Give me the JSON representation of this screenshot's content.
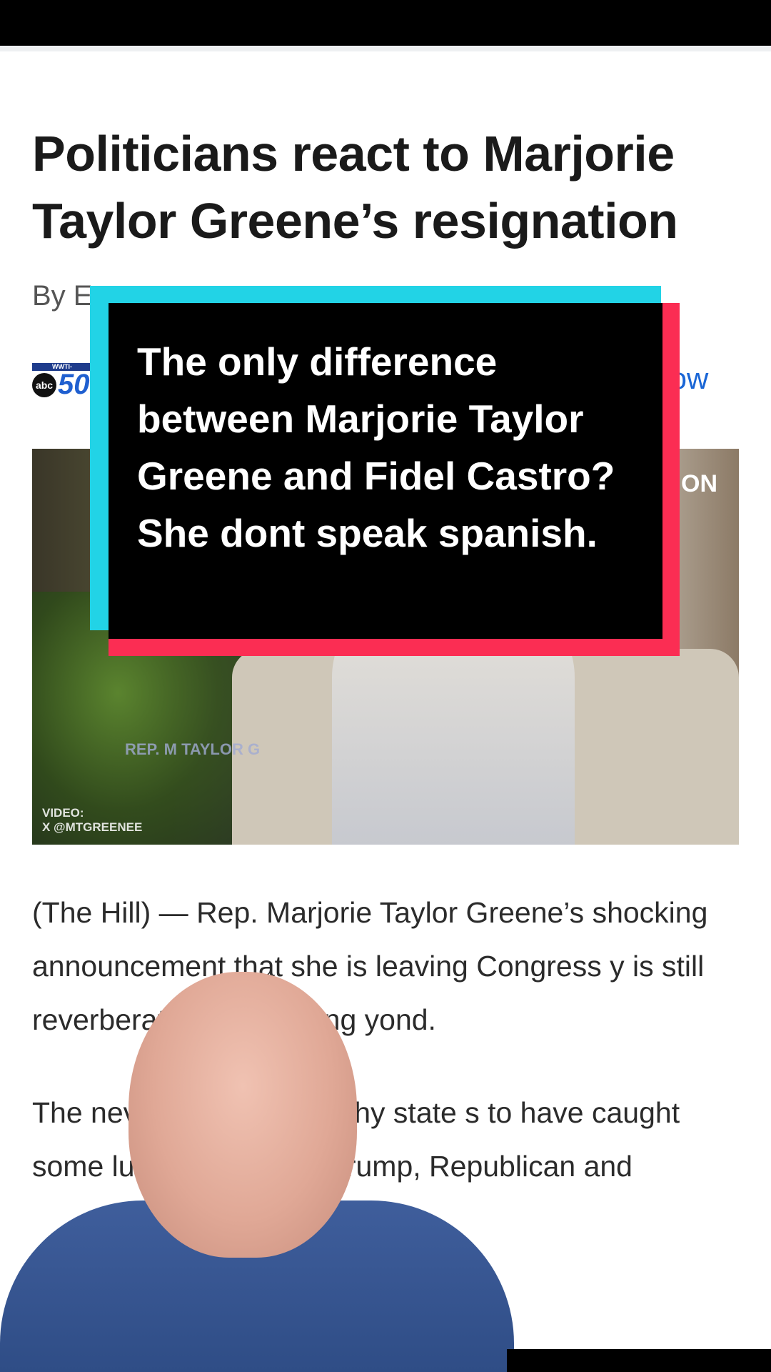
{
  "article": {
    "headline": "Politicians react to Marjorie Taylor Greene’s resignation",
    "byline": "By E",
    "follow_label": "llow",
    "paragraph1": "(The Hill) — Rep. Marjorie Taylor Greene’s shocking announcement that she is leaving Congress y is still reverberating in Washing yond.",
    "paragraph2": "The nev Friday in a lengthy state s to have caught some luding President Trump, Republican and"
  },
  "station_logo": {
    "top": "WWTI-WATERTOWN",
    "abc": "abc",
    "number": "50"
  },
  "video": {
    "lower_third": "REP. M TAYLOR G",
    "credit": "VIDEO:\nX @MTGREENEE",
    "corner": "ON"
  },
  "caption": {
    "text": "The only difference between Marjorie Taylor Greene and Fidel Castro? She dont speak spanish."
  },
  "colors": {
    "caption_cyan": "#22d3e6",
    "caption_red": "#fb2d53",
    "link_blue": "#1a66d6"
  }
}
